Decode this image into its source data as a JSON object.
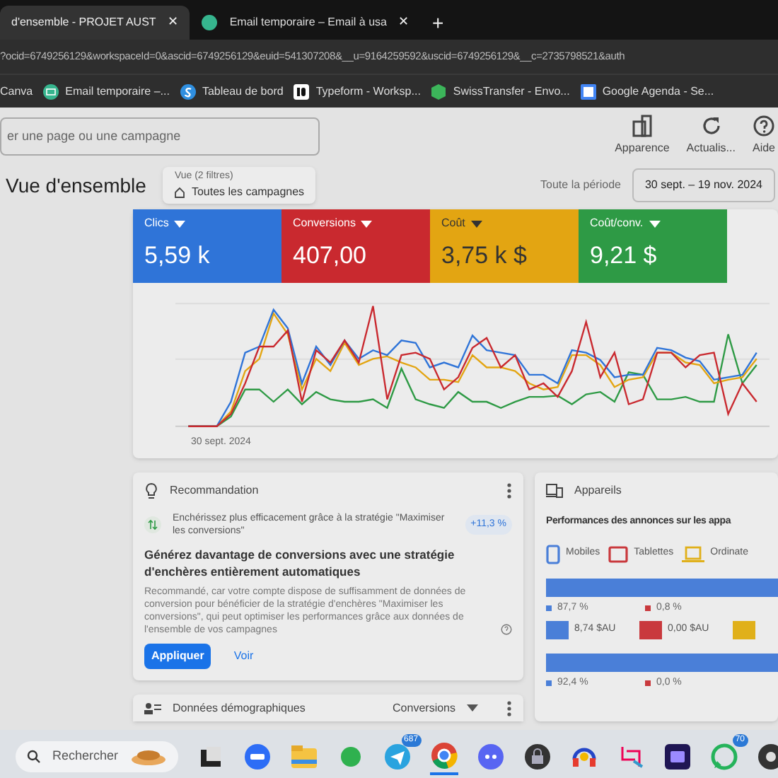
{
  "browser": {
    "tabs": [
      {
        "title": "d'ensemble - PROJET AUST",
        "close": "✕",
        "selected": true
      },
      {
        "title": "Email temporaire – Email à usa",
        "close": "✕",
        "selected": false
      }
    ],
    "new_tab": "+",
    "url": "?ocid=6749256129&workspaceId=0&ascid=6749256129&euid=541307208&__u=9164259592&uscid=6749256129&__c=2735798521&auth",
    "bookmarks": [
      {
        "label": "Canva",
        "kind": "none"
      },
      {
        "label": "Email temporaire –...",
        "kind": "mail"
      },
      {
        "label": "Tableau de bord",
        "kind": "s"
      },
      {
        "label": "Typeform - Worksp...",
        "kind": "typeform"
      },
      {
        "label": "SwissTransfer - Envo...",
        "kind": "swiss"
      },
      {
        "label": "Google Agenda - Se...",
        "kind": "calendar"
      }
    ]
  },
  "toolbar": {
    "search": {
      "placeholder": "er une page ou une campagne"
    },
    "actions": [
      {
        "label": "Apparence",
        "kind": "appearance"
      },
      {
        "label": "Actualis...",
        "kind": "refresh"
      },
      {
        "label": "Aide",
        "kind": "help"
      }
    ]
  },
  "header": {
    "title": "Vue d'ensemble",
    "filter": {
      "caption": "Vue (2 filtres)",
      "value": "Toutes les campagnes"
    },
    "period_label": "Toute la période",
    "date_range": "30 sept. – 19 nov. 2024"
  },
  "metrics": [
    {
      "label": "Clics",
      "value": "5,59 k",
      "color": "#2f74d8"
    },
    {
      "label": "Conversions",
      "value": "407,00",
      "color": "#c9292f"
    },
    {
      "label": "Coût",
      "value": "3,75 k $",
      "color": "#e3a512"
    },
    {
      "label": "Coût/conv.",
      "value": "9,21 $",
      "color": "#2e9a45"
    }
  ],
  "chart": {
    "x_label": "30 sept. 2024"
  },
  "recommendation": {
    "title": "Recommandation",
    "suggestion": "Enchérissez plus efficacement grâce à la stratégie \"Maximiser les conversions\"",
    "uplift": "+11,3 %",
    "heading": "Générez davantage de conversions avec une stratégie d'enchères entièrement automatiques",
    "body": "Recommandé, car votre compte dispose de suffisamment de données de conversion pour bénéficier de la stratégie d'enchères \"Maximiser les conversions\", qui peut optimiser les performances grâce aux données de l'ensemble de vos campagnes",
    "apply": "Appliquer",
    "view": "Voir"
  },
  "demographics": {
    "title": "Données démographiques",
    "metric": "Conversions"
  },
  "devices": {
    "title": "Appareils",
    "subtitle": "Performances des annonces sur les appa",
    "legend": [
      {
        "label": "Mobiles",
        "color": "#4a7fd8"
      },
      {
        "label": "Tablettes",
        "color": "#c9393d"
      },
      {
        "label": "Ordinate",
        "color": "#e0b01a"
      }
    ],
    "rows": [
      {
        "shares": [
          {
            "text": "87,7 %",
            "color": "#4a7fd8"
          },
          {
            "text": "0,8 %",
            "color": "#c9393d"
          }
        ],
        "costs": [
          {
            "text": "8,74 $AU",
            "color": "#4a7fd8"
          },
          {
            "text": "0,00 $AU",
            "color": "#c9393d"
          },
          {
            "color": "#e0b01a"
          }
        ]
      },
      {
        "shares": [
          {
            "text": "92,4 %",
            "color": "#4a7fd8"
          },
          {
            "text": "0,0 %",
            "color": "#c9393d"
          }
        ],
        "costs": []
      }
    ]
  },
  "taskbar": {
    "search": {
      "placeholder": "Rechercher"
    },
    "apps": [
      {
        "kind": "widgets"
      },
      {
        "kind": "zoom"
      },
      {
        "kind": "folder"
      },
      {
        "kind": "evernote"
      },
      {
        "kind": "telegram",
        "badge": "687"
      },
      {
        "kind": "chrome",
        "selected": true
      },
      {
        "kind": "discord"
      },
      {
        "kind": "lock"
      },
      {
        "kind": "headset"
      },
      {
        "kind": "snip"
      },
      {
        "kind": "premiere"
      },
      {
        "kind": "whatsapp",
        "badge": "70"
      },
      {
        "kind": "obs"
      }
    ]
  }
}
